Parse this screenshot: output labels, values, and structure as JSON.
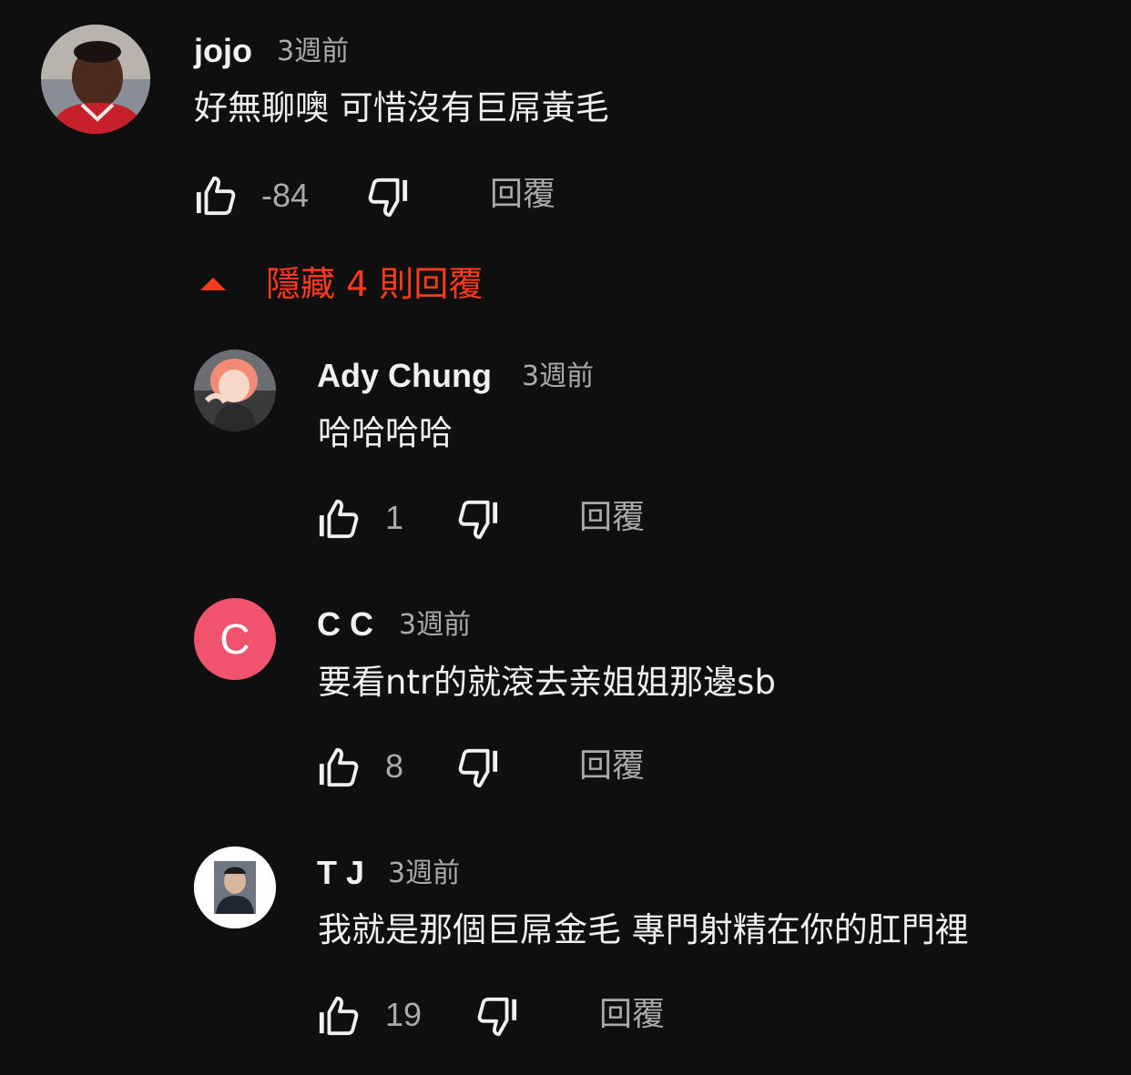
{
  "comment": {
    "author": "jojo",
    "time": "3週前",
    "text": "好無聊噢 可惜沒有巨屌黃毛",
    "likes": "-84",
    "reply_label": "回覆"
  },
  "replies_toggle": {
    "label": "隱藏 4 則回覆",
    "icon": "triangle-up-icon",
    "color": "#ff3b1f"
  },
  "replies": [
    {
      "author": "Ady Chung",
      "time": "3週前",
      "text": "哈哈哈哈",
      "likes": "1",
      "reply_label": "回覆"
    },
    {
      "author": "C C",
      "time": "3週前",
      "text": "要看ntr的就滾去亲姐姐那邊sb",
      "likes": "8",
      "reply_label": "回覆",
      "avatar_letter": "C",
      "avatar_color": "#f0536e"
    },
    {
      "author": "T J",
      "time": "3週前",
      "text": "我就是那個巨屌金毛 專門射精在你的肛門裡",
      "likes": "19",
      "reply_label": "回覆"
    }
  ],
  "colors": {
    "background": "#0f0f0f",
    "primary_text": "#f1f1f1",
    "secondary_text": "#aaaaaa"
  }
}
